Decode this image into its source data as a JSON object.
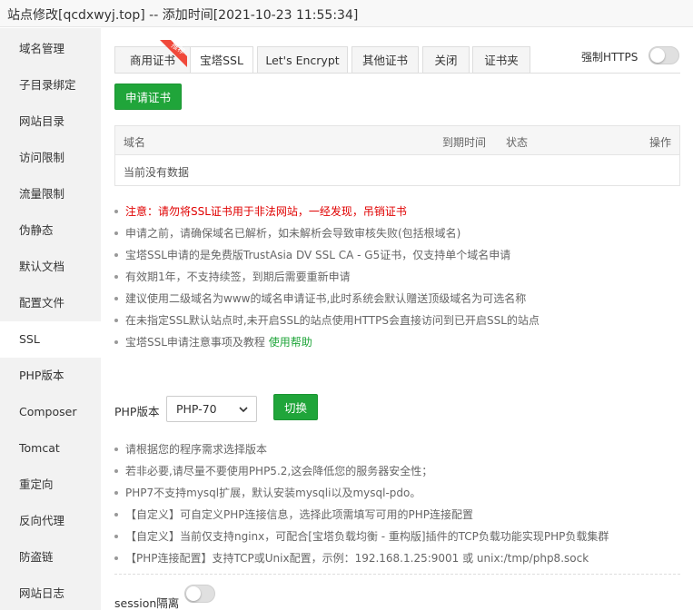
{
  "window": {
    "title": "站点修改[qcdxwyj.top] -- 添加时间[2021-10-23 11:55:34]"
  },
  "sidebar": {
    "items": [
      {
        "label": "域名管理"
      },
      {
        "label": "子目录绑定"
      },
      {
        "label": "网站目录"
      },
      {
        "label": "访问限制"
      },
      {
        "label": "流量限制"
      },
      {
        "label": "伪静态"
      },
      {
        "label": "默认文档"
      },
      {
        "label": "配置文件"
      },
      {
        "label": "SSL"
      },
      {
        "label": "PHP版本"
      },
      {
        "label": "Composer"
      },
      {
        "label": "Tomcat"
      },
      {
        "label": "重定向"
      },
      {
        "label": "反向代理"
      },
      {
        "label": "防盗链"
      },
      {
        "label": "网站日志"
      }
    ],
    "active": "SSL"
  },
  "ssl": {
    "tabs": [
      {
        "label": "商用证书"
      },
      {
        "label": "宝塔SSL"
      },
      {
        "label": "Let's Encrypt"
      },
      {
        "label": "其他证书"
      },
      {
        "label": "关闭"
      },
      {
        "label": "证书夹"
      }
    ],
    "active_tab": "宝塔SSL",
    "badge": "推荐",
    "force_https_label": "强制HTTPS",
    "force_https_on": false,
    "apply_button": "申请证书",
    "table": {
      "headers": {
        "domain": "域名",
        "expire": "到期时间",
        "status": "状态",
        "action": "操作"
      },
      "empty_text": "当前没有数据"
    },
    "notes": [
      "注意：请勿将SSL证书用于非法网站，一经发现，吊销证书",
      "申请之前，请确保域名已解析，如未解析会导致审核失败(包括根域名)",
      "宝塔SSL申请的是免费版TrustAsia DV SSL CA - G5证书，仅支持单个域名申请",
      "有效期1年，不支持续签，到期后需要重新申请",
      "建议使用二级域名为www的域名申请证书,此时系统会默认赠送顶级域名为可选名称",
      "在未指定SSL默认站点时,未开启SSL的站点使用HTTPS会直接访问到已开启SSL的站点"
    ],
    "help_note": {
      "text": "宝塔SSL申请注意事项及教程 ",
      "link": "使用帮助"
    }
  },
  "php": {
    "label": "PHP版本",
    "selected": "PHP-70",
    "switch_button": "切换",
    "notes": [
      "请根据您的程序需求选择版本",
      "若非必要,请尽量不要使用PHP5.2,这会降低您的服务器安全性；",
      "PHP7不支持mysql扩展，默认安装mysqli以及mysql-pdo。",
      "【自定义】可自定义PHP连接信息，选择此项需填写可用的PHP连接配置",
      "【自定义】当前仅支持nginx，可配合[宝塔负载均衡 - 重构版]插件的TCP负载功能实现PHP负载集群",
      "【PHP连接配置】支持TCP或Unix配置，示例：192.168.1.25:9001 或 unix:/tmp/php8.sock"
    ],
    "session_label": "session隔离",
    "session_on": false
  },
  "colors": {
    "accent": "#20a53a",
    "warning": "#e00000",
    "badge": "#f0493b"
  }
}
